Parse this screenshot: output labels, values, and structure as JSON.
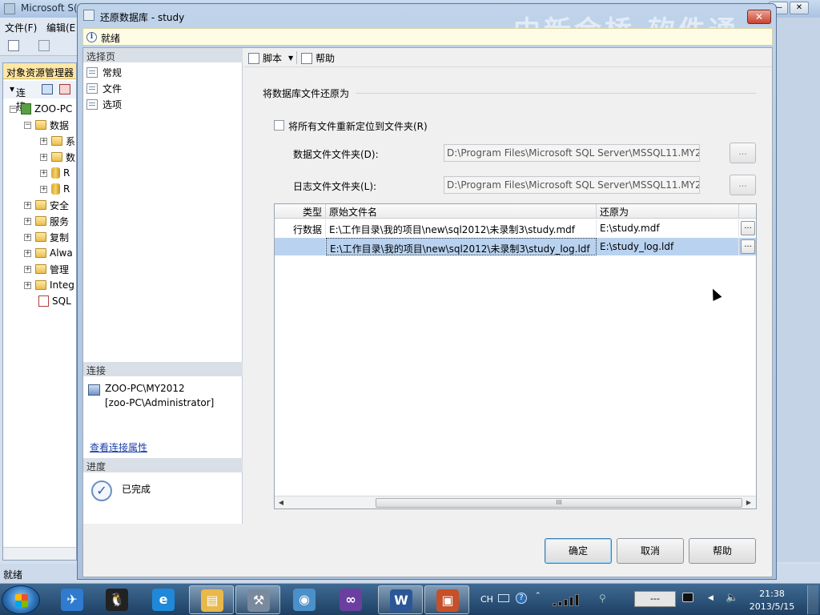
{
  "background_app": {
    "title": "Microsoft S(",
    "menu": [
      "文件(F)",
      "编辑(E"
    ],
    "status": "就绪",
    "object_explorer": {
      "header": "对象资源管理器",
      "connect_label": "连接",
      "tree": [
        {
          "label": "ZOO-PC",
          "expanded": true,
          "icon": "server-icon"
        },
        {
          "label": "数据",
          "expanded": true,
          "icon": "folder-icon"
        },
        {
          "label": "系",
          "expanded": false,
          "icon": "folder-icon"
        },
        {
          "label": "数",
          "expanded": false,
          "icon": "folder-icon"
        },
        {
          "label": "R",
          "expanded": false,
          "icon": "database-icon"
        },
        {
          "label": "R",
          "expanded": false,
          "icon": "database-icon"
        },
        {
          "label": "安全",
          "expanded": false,
          "icon": "folder-icon"
        },
        {
          "label": "服务",
          "expanded": false,
          "icon": "folder-icon"
        },
        {
          "label": "复制",
          "expanded": false,
          "icon": "folder-icon"
        },
        {
          "label": "Alwa",
          "expanded": false,
          "icon": "folder-icon"
        },
        {
          "label": "管理",
          "expanded": false,
          "icon": "folder-icon"
        },
        {
          "label": "Integ",
          "expanded": false,
          "icon": "folder-icon"
        },
        {
          "label": "SQL",
          "expanded": null,
          "icon": "sql-agent-icon"
        }
      ]
    }
  },
  "dialog": {
    "title": "还原数据库 - study",
    "watermark": "中新金桥 软件通",
    "status": "就绪",
    "left": {
      "select_page_header": "选择页",
      "pages": [
        "常规",
        "文件",
        "选项"
      ],
      "connection_header": "连接",
      "server": "ZOO-PC\\MY2012",
      "user": "[zoo-PC\\Administrator]",
      "view_connection_link": "查看连接属性",
      "progress_header": "进度",
      "progress_status": "已完成"
    },
    "toolbar": {
      "script": "脚本",
      "help": "帮助"
    },
    "section_title": "将数据库文件还原为",
    "relocate_checkbox": {
      "label": "将所有文件重新定位到文件夹(R)",
      "checked": false
    },
    "data_folder": {
      "label": "数据文件文件夹(D):",
      "value": "D:\\Program Files\\Microsoft SQL Server\\MSSQL11.MY2"
    },
    "log_folder": {
      "label": "日志文件文件夹(L):",
      "value": "D:\\Program Files\\Microsoft SQL Server\\MSSQL11.MY2"
    },
    "browse_label": "...",
    "grid": {
      "columns": [
        "类型",
        "原始文件名",
        "还原为"
      ],
      "rows": [
        {
          "type": "行数据",
          "original": "E:\\工作目录\\我的项目\\new\\sql2012\\未录制3\\study.mdf",
          "restore_as": "E:\\study.mdf",
          "button": "...",
          "selected": false
        },
        {
          "type": "",
          "original": "E:\\工作目录\\我的项目\\new\\sql2012\\未录制3\\study_log.ldf",
          "restore_as": "E:\\study_log.ldf",
          "button": "...",
          "selected": true
        }
      ],
      "scroll_grip": "III"
    },
    "buttons": {
      "ok": "确定",
      "cancel": "取消",
      "help": "帮助"
    }
  },
  "taskbar": {
    "apps": [
      {
        "name": "bird-app-icon",
        "glyph": "✈",
        "color": "#2e7bcf",
        "open": false
      },
      {
        "name": "qq-icon",
        "glyph": "🐧",
        "color": "#222222",
        "open": false
      },
      {
        "name": "ie-icon",
        "glyph": "e",
        "color": "#1f88d8",
        "open": false
      },
      {
        "name": "explorer-icon",
        "glyph": "▤",
        "color": "#e8b84a",
        "open": true
      },
      {
        "name": "ssms-icon",
        "glyph": "⚒",
        "color": "#7a8a9c",
        "open": true
      },
      {
        "name": "search-app-icon",
        "glyph": "◉",
        "color": "#4a90c9",
        "open": false
      },
      {
        "name": "vs-icon",
        "glyph": "∞",
        "color": "#6a3f9f",
        "open": false
      },
      {
        "name": "word-icon",
        "glyph": "W",
        "color": "#2b5797",
        "open": true
      },
      {
        "name": "ppt-icon",
        "glyph": "▣",
        "color": "#c5502a",
        "open": true
      }
    ],
    "lang": "CH",
    "blank_indicator": "---",
    "time": "21:38",
    "date": "2013/5/15"
  }
}
